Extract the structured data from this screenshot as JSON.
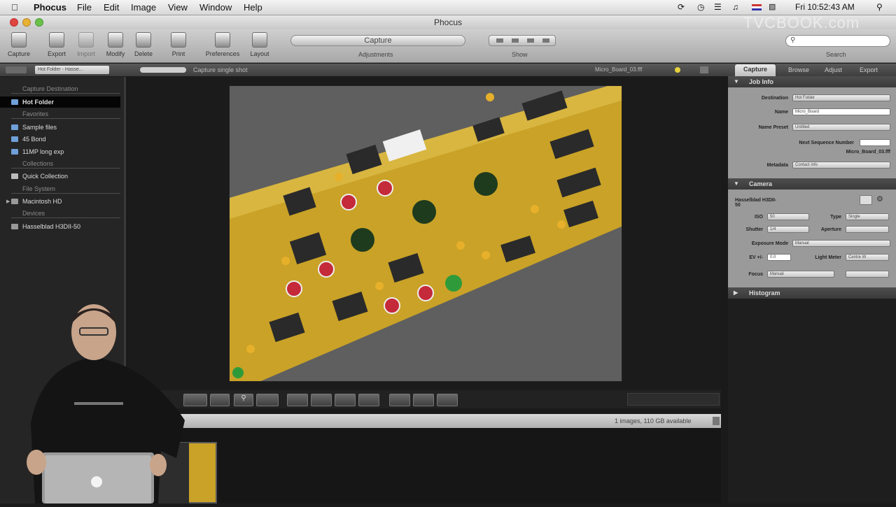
{
  "menubar": {
    "app": "Phocus",
    "items": [
      "File",
      "Edit",
      "Image",
      "View",
      "Window",
      "Help"
    ],
    "clock": "Fri 10:52:43 AM"
  },
  "window": {
    "title": "Phocus",
    "watermark": "TVCBOOK.com"
  },
  "toolbar": {
    "buttons": [
      {
        "label": "Capture"
      },
      {
        "label": "Export"
      },
      {
        "label": "Import"
      },
      {
        "label": "Modify"
      },
      {
        "label": "Delete"
      },
      {
        "label": "Print"
      },
      {
        "label": "Preferences"
      },
      {
        "label": "Layout"
      }
    ],
    "segment_label": "Capture",
    "adjustments_label": "Adjustments",
    "show_label": "Show",
    "search_label": "Search",
    "search_placeholder": ""
  },
  "subbar": {
    "folder_select": "Hot Folder - Hasse...",
    "capture_mode": "Capture single shot",
    "filename": "Micro_Board_03.fff"
  },
  "sidebar": {
    "sections": [
      {
        "header": "Capture Destination",
        "items": [
          "Hot Folder"
        ]
      },
      {
        "header": "Favorites",
        "items": [
          "Sample files",
          "45 Bond",
          "11MP long exp"
        ]
      },
      {
        "header": "Collections",
        "items": [
          "Quick Collection"
        ]
      },
      {
        "header": "File System",
        "items": [
          "Macintosh HD"
        ]
      },
      {
        "header": "Devices",
        "items": [
          "Hasselblad H3DII-50"
        ]
      }
    ]
  },
  "filmstrip": {
    "status": "1 images, 110 GB available"
  },
  "right_panel": {
    "tabs": [
      "Capture",
      "Browse",
      "Adjust",
      "Export"
    ],
    "job_info": {
      "title": "Job Info",
      "destination_label": "Destination",
      "destination": "Hot Folder",
      "name_label": "Name",
      "name": "Micro_Board",
      "name_preset_label": "Name Preset",
      "name_preset": "Untitled",
      "next_seq_label": "Next Sequence Number",
      "next_file": "Micro_Board_03.fff",
      "metadata_label": "Metadata",
      "metadata": "Contact info"
    },
    "camera": {
      "title": "Camera",
      "model": "Hasselblad H3DII-50",
      "iso_label": "ISO",
      "iso": "50",
      "type_label": "Type",
      "type": "Single",
      "shutter_label": "Shutter",
      "shutter": "1/4",
      "aperture_label": "Aperture",
      "aperture": "",
      "exposure_mode_label": "Exposure Mode",
      "exposure_mode": "Manual",
      "ev_label": "EV +/-",
      "ev": "0.0",
      "light_meter_label": "Light Meter",
      "light_meter": "Centre W",
      "focus_label": "Focus",
      "focus": "Manual"
    },
    "histogram": {
      "title": "Histogram"
    }
  },
  "colors": {
    "accent": "#6fa0d8",
    "board": "#c9a227",
    "background": "#1b1b1b"
  }
}
